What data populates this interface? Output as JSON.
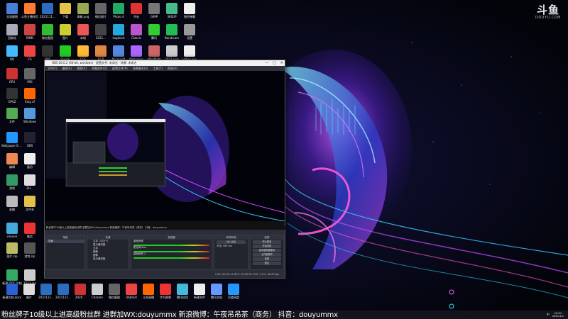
{
  "brand": {
    "logo_main": "斗鱼",
    "logo_sub": "DOUYU.COM"
  },
  "colors": {
    "accent_cyan": "#22d0ff",
    "accent_magenta": "#d43fe8",
    "obs_bg": "#2b2e38"
  },
  "desktop_icons": [
    {
      "label": "全局截图",
      "color": "#4a7fd6",
      "col": 0,
      "row": 0
    },
    {
      "label": "斗鱼主播伴侣",
      "color": "#ff7b2e",
      "col": 1,
      "row": 0
    },
    {
      "label": "2021111...",
      "color": "#2d6dbf",
      "col": 2,
      "row": 0
    },
    {
      "label": "下载",
      "color": "#e8c34a",
      "col": 3,
      "row": 0
    },
    {
      "label": "青春.png",
      "color": "#9a5",
      "col": 4,
      "row": 0
    },
    {
      "label": "微信图片",
      "color": "#666",
      "col": 5,
      "row": 0
    },
    {
      "label": "Photo 4",
      "color": "#2a6",
      "col": 6,
      "row": 0
    },
    {
      "label": "开启",
      "color": "#d33",
      "col": 7,
      "row": 0
    },
    {
      "label": "GIMP",
      "color": "#777",
      "col": 8,
      "row": 0
    },
    {
      "label": "360UP",
      "color": "#4b8",
      "col": 9,
      "row": 0
    },
    {
      "label": "独特弹幕",
      "color": "#eee",
      "col": 10,
      "row": 0
    },
    {
      "label": "回收站",
      "color": "#aab",
      "col": 0,
      "row": 1
    },
    {
      "label": "MMD",
      "color": "#c44",
      "col": 1,
      "row": 1
    },
    {
      "label": "微信截图",
      "color": "#3b3",
      "col": 2,
      "row": 1
    },
    {
      "label": "图片",
      "color": "#cc3",
      "col": 3,
      "row": 1
    },
    {
      "label": "本地",
      "color": "#e55",
      "col": 4,
      "row": 1
    },
    {
      "label": "2021...",
      "color": "#444",
      "col": 5,
      "row": 1
    },
    {
      "label": "Logitech",
      "color": "#2ad",
      "col": 6,
      "row": 1
    },
    {
      "label": "Classic",
      "color": "#b5c",
      "col": 7,
      "row": 1
    },
    {
      "label": "腾讯",
      "color": "#3c3",
      "col": 8,
      "row": 1
    },
    {
      "label": "Bandicam",
      "color": "#2b5",
      "col": 9,
      "row": 1
    },
    {
      "label": "设置",
      "color": "#999",
      "col": 10,
      "row": 1
    },
    {
      "label": "QQ",
      "color": "#4bf",
      "col": 0,
      "row": 2
    },
    {
      "label": "CS",
      "color": "#e44",
      "col": 1,
      "row": 2
    },
    {
      "label": "OBS",
      "color": "#333",
      "col": 2,
      "row": 2
    },
    {
      "label": "Steam",
      "color": "#2c2",
      "col": 3,
      "row": 2
    },
    {
      "label": "CGS",
      "color": "#fb3",
      "col": 4,
      "row": 2
    },
    {
      "label": "RGB",
      "color": "#d84",
      "col": 5,
      "row": 2
    },
    {
      "label": "Microsoft",
      "color": "#58d",
      "col": 6,
      "row": 2
    },
    {
      "label": "Wallpaper",
      "color": "#a6f",
      "col": 7,
      "row": 2
    },
    {
      "label": "AfterMath",
      "color": "#c66",
      "col": 8,
      "row": 2
    },
    {
      "label": "2021.png",
      "color": "#ccc",
      "col": 9,
      "row": 2
    },
    {
      "label": "Valley.exe",
      "color": "#eee",
      "col": 10,
      "row": 2
    },
    {
      "label": "GPU",
      "color": "#c33",
      "col": 0,
      "row": 3
    },
    {
      "label": "MSI",
      "color": "#666",
      "col": 1,
      "row": 3
    },
    {
      "label": "GPUZ",
      "color": "#333",
      "col": 0,
      "row": 4
    },
    {
      "label": "King of",
      "color": "#f60",
      "col": 1,
      "row": 4
    },
    {
      "label": "文件",
      "color": "#5a5",
      "col": 0,
      "row": 5
    },
    {
      "label": "Windows",
      "color": "#59d",
      "col": 1,
      "row": 5
    },
    {
      "label": "Wallpaper Engine",
      "color": "#29f",
      "col": 0,
      "row": 6
    },
    {
      "label": "OBS",
      "color": "#223",
      "col": 1,
      "row": 6
    },
    {
      "label": "编辑",
      "color": "#e85",
      "col": 0,
      "row": 7
    },
    {
      "label": "备份",
      "color": "#eee",
      "col": 1,
      "row": 7
    },
    {
      "label": "游戏",
      "color": "#396",
      "col": 0,
      "row": 8
    },
    {
      "label": "ZH...",
      "color": "#ddd",
      "col": 1,
      "row": 8
    },
    {
      "label": "直播",
      "color": "#bbb",
      "col": 0,
      "row": 9
    },
    {
      "label": "文件夹",
      "color": "#e3c04a",
      "col": 1,
      "row": 9
    },
    {
      "label": "cleaner",
      "color": "#4ad",
      "col": 0,
      "row": 10
    },
    {
      "label": "微信",
      "color": "#e33",
      "col": 1,
      "row": 10
    },
    {
      "label": "图片.zip",
      "color": "#bb6",
      "col": 0,
      "row": 11
    },
    {
      "label": "游戏.zip",
      "color": "#555",
      "col": 1,
      "row": 11
    },
    {
      "label": "新建 DOC 文档",
      "color": "#3a6",
      "col": 0,
      "row": 12
    },
    {
      "label": "1213.jpg",
      "color": "#ccc",
      "col": 1,
      "row": 12
    }
  ],
  "bottom_icons": [
    {
      "label": "新建文档.docx",
      "color": "#2b5fd6"
    },
    {
      "label": "图片",
      "color": "#ddd"
    },
    {
      "label": "2021111...",
      "color": "#2d6dbf"
    },
    {
      "label": "2021111...",
      "color": "#2d6dbf"
    },
    {
      "label": "2020...",
      "color": "#c33"
    },
    {
      "label": "Chrome",
      "color": "#ccc"
    },
    {
      "label": "微信截图",
      "color": "#666"
    },
    {
      "label": "UABInst",
      "color": "#e44"
    },
    {
      "label": "斗鱼直播",
      "color": "#f60"
    },
    {
      "label": "华为视频",
      "color": "#e33"
    },
    {
      "label": "腾讯应用",
      "color": "#4bd"
    },
    {
      "label": "新建文件",
      "color": "#eee"
    },
    {
      "label": "腾讯文档",
      "color": "#69f"
    },
    {
      "label": "百度网盘",
      "color": "#29f"
    }
  ],
  "obs": {
    "title": "OBS 26.0.2 (64-bit, windows) - 配置文件: 未命名 - 场景: 未命名",
    "window_controls": [
      "—",
      "□",
      "✕"
    ],
    "menu": [
      "文件(F)",
      "编辑(E)",
      "视图(V)",
      "停靠部件(D)",
      "配置文件(P)",
      "场景集合(S)",
      "工具(T)",
      "帮助(H)"
    ],
    "ticker": "粉丝牌子10级以上进高级粉丝群 进群加WX:douyummx 新浪微博：午夜吊吊茶（商务） 抖音：douyummx",
    "docks": {
      "scenes": {
        "title": "场景",
        "items": [
          "场景"
        ]
      },
      "sources": {
        "title": "来源",
        "items": [
          "文本（GDI+）",
          "显示器采集",
          "文本",
          "图像",
          "图像",
          "显示器采集"
        ]
      },
      "mixer": {
        "title": "混音器",
        "items": [
          "桌面音频",
          "麦克风/Aux",
          "桌面音频 2"
        ]
      },
      "transitions": {
        "title": "转场特效",
        "mode": "淡入淡出",
        "duration_label": "时长",
        "duration": "300 ms"
      },
      "controls": {
        "title": "控制",
        "buttons": [
          "停止推流",
          "开始录制",
          "启动虚拟摄像机",
          "工作室模式",
          "设置",
          "退出"
        ]
      }
    },
    "status": "LIVE: 00:32:11  REC: 00:00:00  CPU: 3.1%, 60.00 fps"
  },
  "promo_text": "粉丝牌子10级以上进高级粉丝群 进群加WX:douyummx 新浪微博：午夜吊吊茶（商务） 抖音：douyummx",
  "tray": {
    "ime": "中",
    "time": "19:01",
    "date": "2021/1/1"
  }
}
